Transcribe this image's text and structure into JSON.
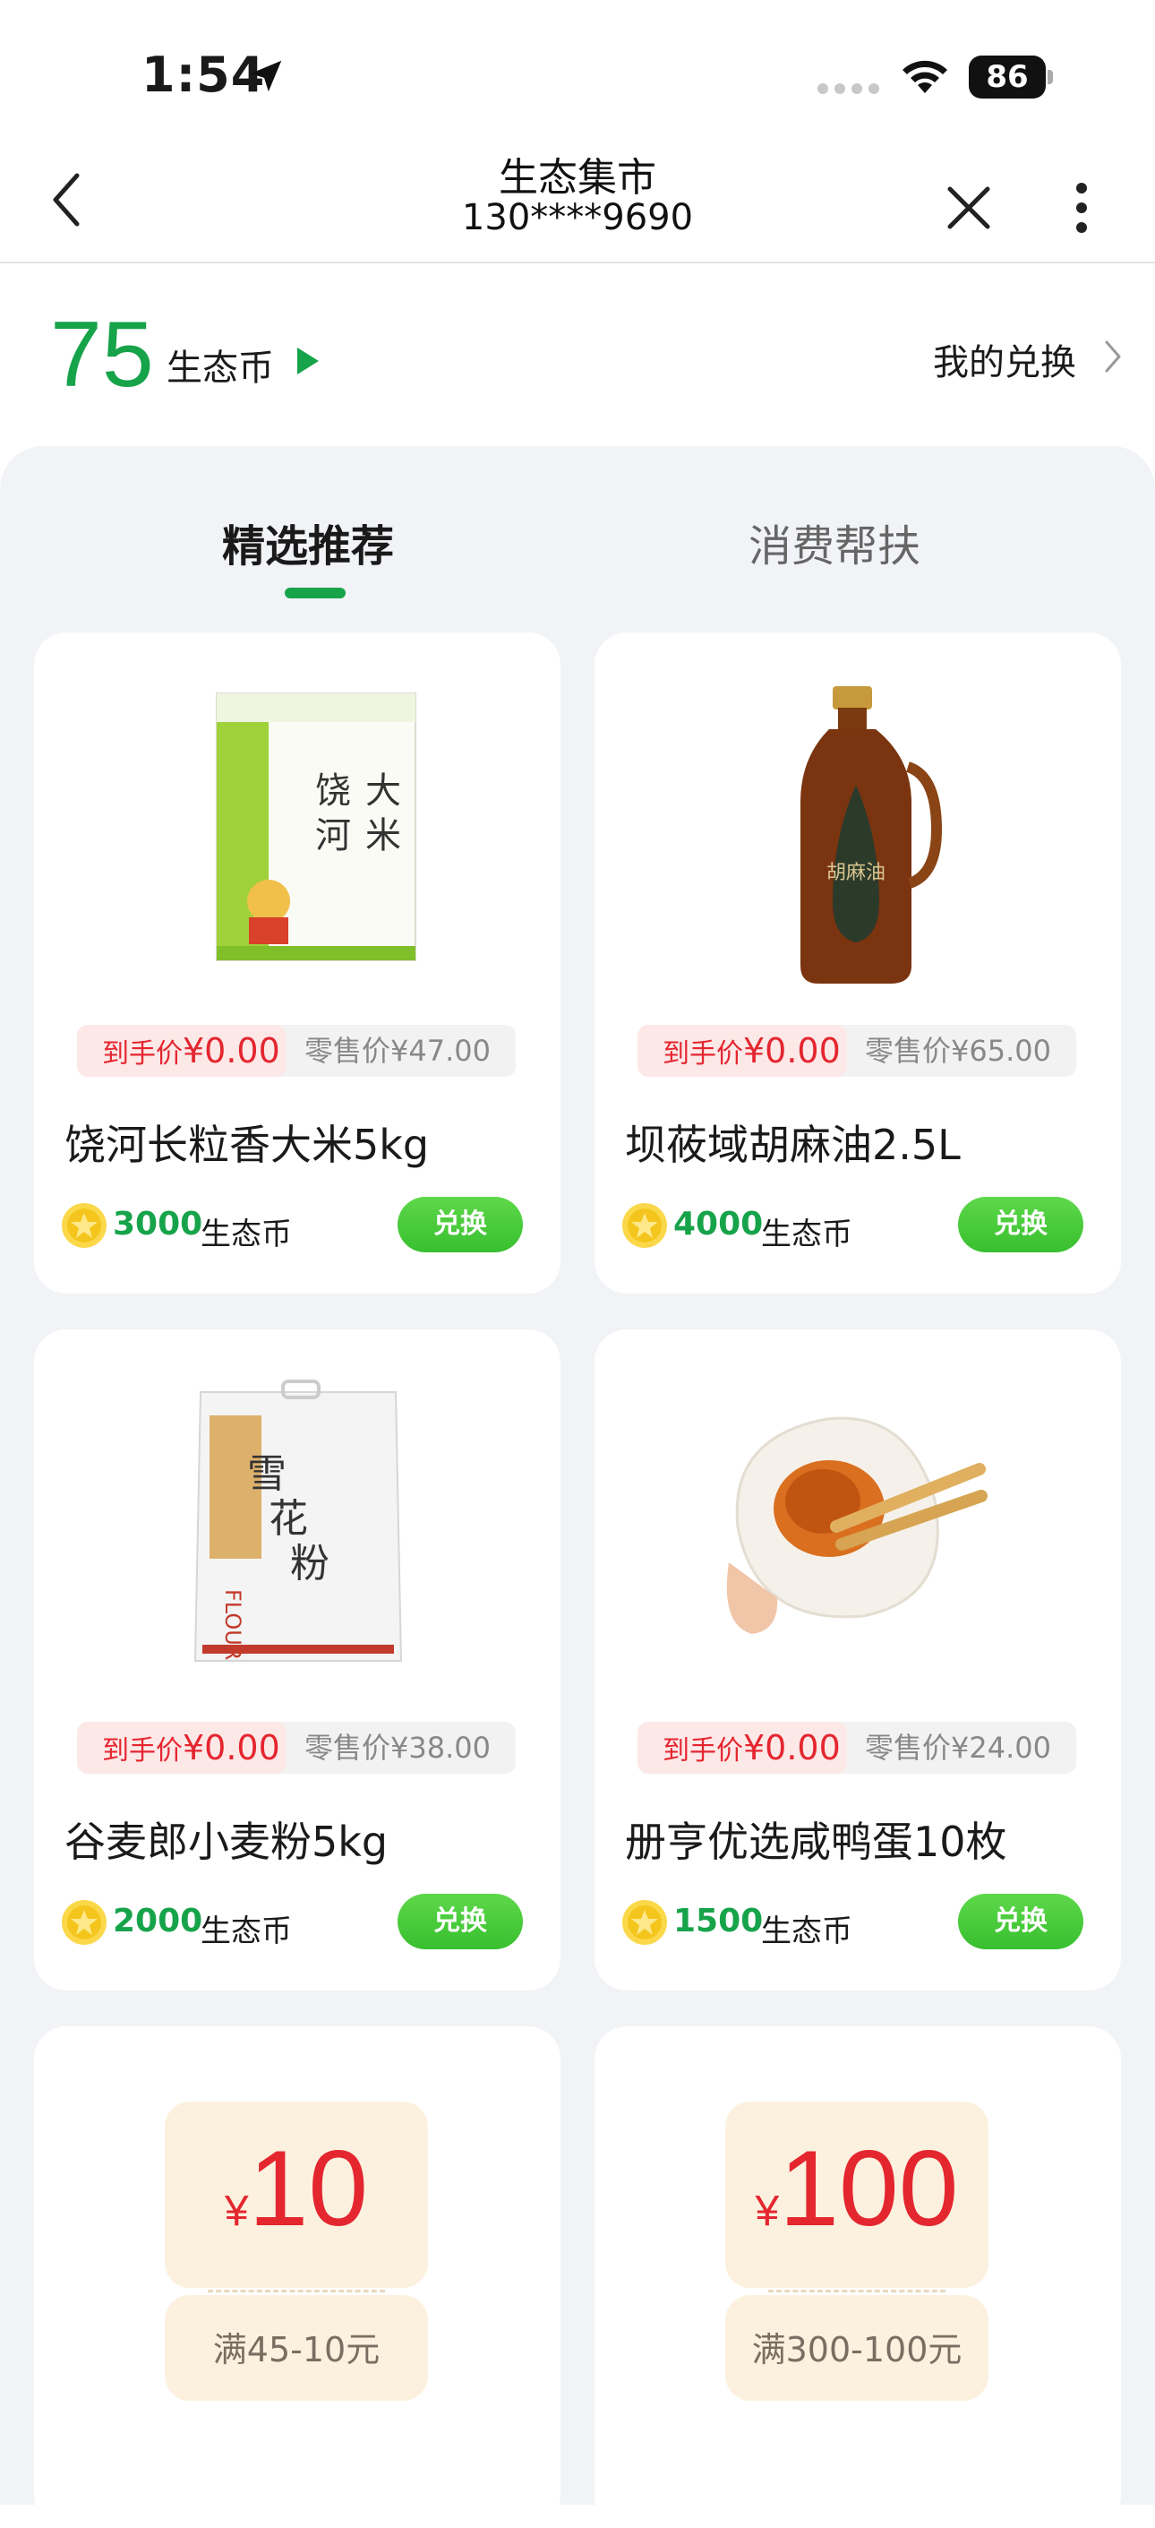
{
  "status_bar": {
    "time": "1:54",
    "battery": "86"
  },
  "nav": {
    "title": "生态集市",
    "subtitle": "130****9690"
  },
  "wallet": {
    "coins": "75",
    "unit": "生态币",
    "my_exchange": "我的兑换"
  },
  "tabs": [
    {
      "label": "精选推荐",
      "active": true
    },
    {
      "label": "消费帮扶",
      "active": false
    }
  ],
  "products": [
    {
      "promo_label": "到手价",
      "promo_price": "¥0.00",
      "retail": "零售价¥47.00",
      "name": "饶河长粒香大米5kg",
      "coins": "3000",
      "coin_unit": "生态币",
      "button": "兑换",
      "image": "rice-bag-icon"
    },
    {
      "promo_label": "到手价",
      "promo_price": "¥0.00",
      "retail": "零售价¥65.00",
      "name": "坝莜域胡麻油2.5L",
      "coins": "4000",
      "coin_unit": "生态币",
      "button": "兑换",
      "image": "oil-bottle-icon"
    },
    {
      "promo_label": "到手价",
      "promo_price": "¥0.00",
      "retail": "零售价¥38.00",
      "name": "谷麦郎小麦粉5kg",
      "coins": "2000",
      "coin_unit": "生态币",
      "button": "兑换",
      "image": "flour-bag-icon"
    },
    {
      "promo_label": "到手价",
      "promo_price": "¥0.00",
      "retail": "零售价¥24.00",
      "name": "册亨优选咸鸭蛋10枚",
      "coins": "1500",
      "coin_unit": "生态币",
      "button": "兑换",
      "image": "salted-egg-icon"
    }
  ],
  "coupons": [
    {
      "currency": "¥",
      "amount": "10",
      "condition": "满45-10元"
    },
    {
      "currency": "¥",
      "amount": "100",
      "condition": "满300-100元"
    }
  ],
  "colors": {
    "accent_green": "#17a34a",
    "promo_red": "#e4262f",
    "panel_bg": "#f1f3f6"
  }
}
